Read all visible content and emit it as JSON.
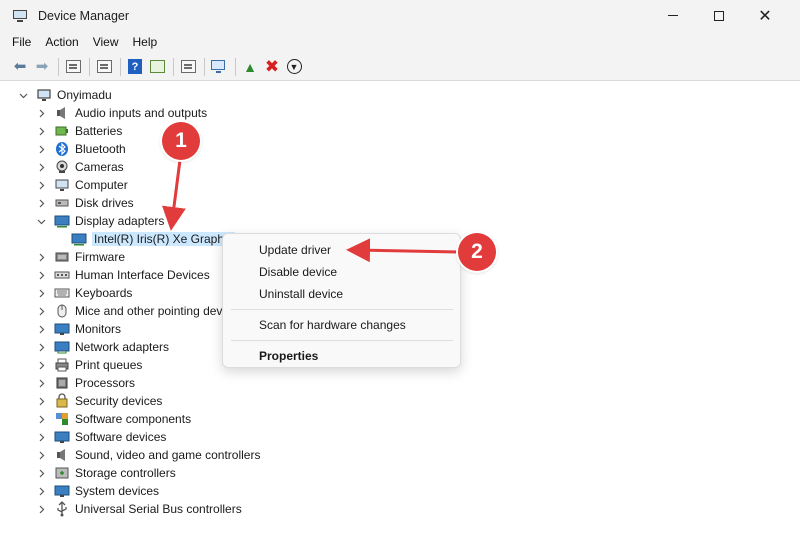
{
  "window": {
    "title": "Device Manager"
  },
  "menu": [
    "File",
    "Action",
    "View",
    "Help"
  ],
  "tree": {
    "root": "Onyimadu",
    "categories": [
      {
        "label": "Audio inputs and outputs",
        "icon": "speaker-icon"
      },
      {
        "label": "Batteries",
        "icon": "battery-icon"
      },
      {
        "label": "Bluetooth",
        "icon": "bluetooth-icon"
      },
      {
        "label": "Cameras",
        "icon": "camera-icon"
      },
      {
        "label": "Computer",
        "icon": "computer-icon"
      },
      {
        "label": "Disk drives",
        "icon": "disk-icon"
      },
      {
        "label": "Display adapters",
        "icon": "display-adapter-icon",
        "expanded": true
      },
      {
        "label": "Firmware",
        "icon": "firmware-icon"
      },
      {
        "label": "Human Interface Devices",
        "icon": "hid-icon"
      },
      {
        "label": "Keyboards",
        "icon": "keyboard-icon"
      },
      {
        "label": "Mice and other pointing dev",
        "icon": "mouse-icon"
      },
      {
        "label": "Monitors",
        "icon": "monitor-icon"
      },
      {
        "label": "Network adapters",
        "icon": "network-icon"
      },
      {
        "label": "Print queues",
        "icon": "printer-icon"
      },
      {
        "label": "Processors",
        "icon": "processor-icon"
      },
      {
        "label": "Security devices",
        "icon": "security-icon"
      },
      {
        "label": "Software components",
        "icon": "software-component-icon"
      },
      {
        "label": "Software devices",
        "icon": "software-device-icon"
      },
      {
        "label": "Sound, video and game controllers",
        "icon": "sound-icon"
      },
      {
        "label": "Storage controllers",
        "icon": "storage-icon"
      },
      {
        "label": "System devices",
        "icon": "system-icon"
      },
      {
        "label": "Universal Serial Bus controllers",
        "icon": "usb-icon"
      }
    ],
    "display_child": "Intel(R) Iris(R) Xe Graphic"
  },
  "context_menu": {
    "update": "Update driver",
    "disable": "Disable device",
    "uninstall": "Uninstall device",
    "scan": "Scan for hardware changes",
    "properties": "Properties"
  },
  "annotations": {
    "one": "1",
    "two": "2"
  },
  "colors": {
    "selection": "#cce8ff",
    "annotation": "#e23b3b",
    "chrome": "#f3f3f3"
  }
}
